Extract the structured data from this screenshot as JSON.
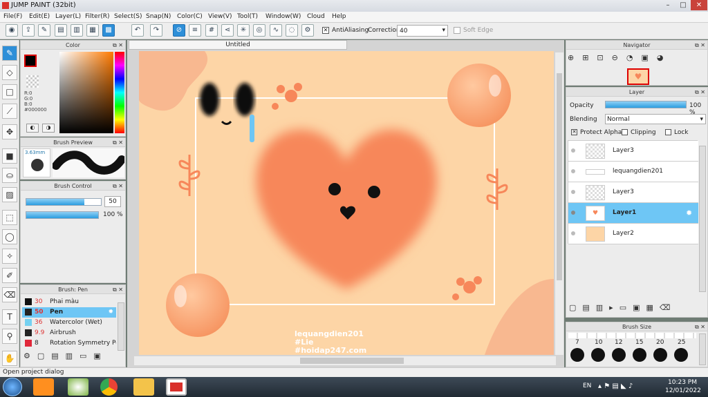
{
  "app": {
    "title": "JUMP PAINT (32bit)",
    "window_controls": [
      "–",
      "□",
      "✕"
    ]
  },
  "menu": [
    "File(F)",
    "Edit(E)",
    "Layer(L)",
    "Filter(R)",
    "Select(S)",
    "Snap(N)",
    "Color(C)",
    "View(V)",
    "Tool(T)",
    "Window(W)",
    "Cloud",
    "Help"
  ],
  "toolbar": {
    "antialias_label": "AntiAliasing",
    "correction_label": "Correction",
    "correction_value": "40",
    "soft_edge_label": "Soft Edge"
  },
  "color_panel": {
    "title": "Color",
    "rgb": [
      "R:0",
      "G:0",
      "B:0"
    ],
    "hex": "#000000"
  },
  "brush_preview": {
    "title": "Brush Preview",
    "size": "3.63mm"
  },
  "brush_control": {
    "title": "Brush Control",
    "size_value": "50",
    "opacity_value": "100 %"
  },
  "brush_list": {
    "title": "Brush: Pen",
    "items": [
      {
        "size": "30",
        "name": "Phai màu",
        "color": "#111111"
      },
      {
        "size": "50",
        "name": "Pen",
        "color": "#222222"
      },
      {
        "size": "36",
        "name": "Watercolor (Wet)",
        "color": "#74d1f1"
      },
      {
        "size": "9.9",
        "name": "Airbrush",
        "color": "#222222"
      },
      {
        "size": "8",
        "name": "Rotation Symmetry Pen",
        "color": "#e0283a"
      }
    ]
  },
  "canvas": {
    "tab": "Untitled",
    "watermark": [
      "lequangdien201",
      "#Lie",
      "#hoidap247.com"
    ]
  },
  "navigator": {
    "title": "Navigator"
  },
  "layer_panel": {
    "title": "Layer",
    "opacity_label": "Opacity",
    "opacity_value": "100 %",
    "blending_label": "Blending",
    "blending_value": "Normal",
    "protect_alpha": "Protect Alpha",
    "clipping": "Clipping",
    "lock": "Lock",
    "layers": [
      "Layer3",
      "lequangdien201",
      "Layer3",
      "Layer1",
      "Layer2"
    ]
  },
  "brush_size": {
    "title": "Brush Size",
    "sizes": [
      "7",
      "10",
      "12",
      "15",
      "20",
      "25"
    ]
  },
  "status": {
    "text": "Open project dialog"
  },
  "taskbar": {
    "lang": "EN",
    "time": "10:23 PM",
    "date": "12/01/2022"
  },
  "colors": {
    "accent": "#2e8fd8",
    "canvas_bg": "#fdd5a6",
    "heart": "#f7875a"
  }
}
